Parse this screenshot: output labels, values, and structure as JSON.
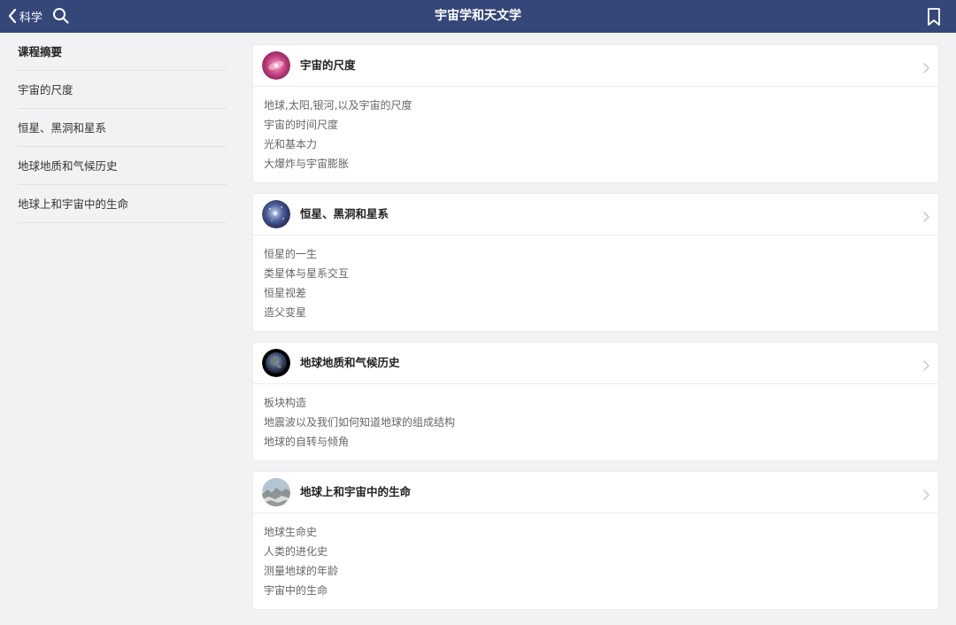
{
  "nav": {
    "back_label": "科学",
    "title": "宇宙学和天文学",
    "back_icon": "chevron-left-icon",
    "search_icon": "search-icon",
    "bookmark_icon": "bookmark-icon",
    "bar_color": "#344778"
  },
  "sidebar": {
    "items": [
      {
        "label": "课程摘要"
      },
      {
        "label": "宇宙的尺度"
      },
      {
        "label": "恒星、黑洞和星系"
      },
      {
        "label": "地球地质和气候历史"
      },
      {
        "label": "地球上和宇宙中的生命"
      }
    ]
  },
  "sections": [
    {
      "title": "宇宙的尺度",
      "topics": [
        "地球,太阳,银河,以及宇宙的尺度",
        "宇宙的时间尺度",
        "光和基本力",
        "大爆炸与宇宙膨胀"
      ]
    },
    {
      "title": "恒星、黑洞和星系",
      "topics": [
        "恒星的一生",
        "类星体与星系交互",
        "恒星视差",
        "造父变星"
      ]
    },
    {
      "title": "地球地质和气候历史",
      "topics": [
        "板块构造",
        "地震波以及我们如何知道地球的组成结构",
        "地球的自转与倾角"
      ]
    },
    {
      "title": "地球上和宇宙中的生命",
      "topics": [
        "地球生命史",
        "人类的进化史",
        "测量地球的年龄",
        "宇宙中的生命"
      ]
    }
  ]
}
